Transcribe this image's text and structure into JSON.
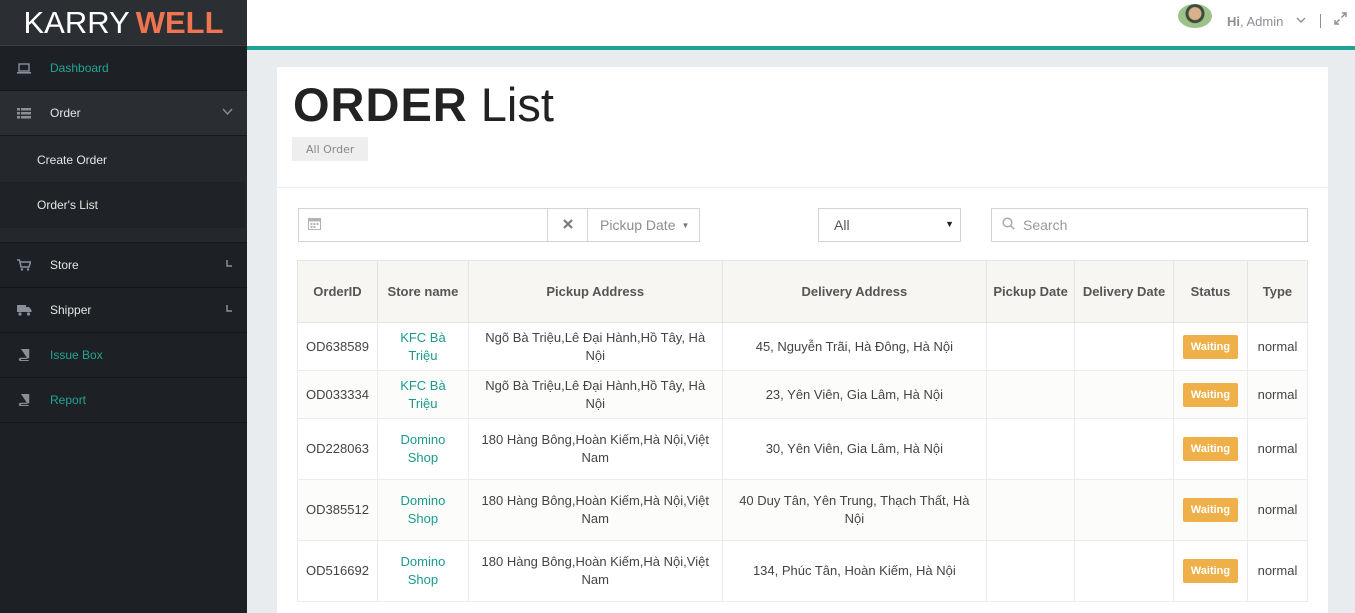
{
  "brand": {
    "first": "KARRY",
    "second": "WELL"
  },
  "sidebar": {
    "items": [
      {
        "label": "Dashboard",
        "icon": "laptop-icon"
      },
      {
        "label": "Order",
        "icon": "list-icon"
      },
      {
        "label": "Store",
        "icon": "cart-icon"
      },
      {
        "label": "Shipper",
        "icon": "truck-icon"
      },
      {
        "label": "Issue Box",
        "icon": "book-icon"
      },
      {
        "label": "Report",
        "icon": "book-icon"
      }
    ],
    "order_submenu": [
      {
        "label": "Create Order"
      },
      {
        "label": "Order's List"
      }
    ]
  },
  "header": {
    "greeting_bold": "Hi",
    "greeting_rest": ", Admin"
  },
  "page": {
    "title_bold": "ORDER",
    "title_light": "List",
    "breadcrumb": "All Order"
  },
  "filters": {
    "date_value": "",
    "pickup_date_label": "Pickup Date",
    "status_select": "All",
    "search_placeholder": "Search"
  },
  "table": {
    "headers": [
      "OrderID",
      "Store name",
      "Pickup Address",
      "Delivery Address",
      "Pickup Date",
      "Delivery Date",
      "Status",
      "Type"
    ],
    "rows": [
      {
        "id": "OD638589",
        "store": "KFC Bà Triệu",
        "pickup": "Ngõ Bà Triệu,Lê Đại Hành,Hồ Tây, Hà Nội",
        "delivery": "45, Nguyễn Trãi, Hà Đông, Hà Nội",
        "pickup_date": "",
        "delivery_date": "",
        "status": "Waiting",
        "type": "normal"
      },
      {
        "id": "OD033334",
        "store": "KFC Bà Triệu",
        "pickup": "Ngõ Bà Triệu,Lê Đại Hành,Hồ Tây, Hà Nội",
        "delivery": "23, Yên Viên, Gia Lâm, Hà Nội",
        "pickup_date": "",
        "delivery_date": "",
        "status": "Waiting",
        "type": "normal"
      },
      {
        "id": "OD228063",
        "store": "Domino Shop",
        "pickup": "180 Hàng Bông,Hoàn Kiếm,Hà Nội,Việt Nam",
        "delivery": "30, Yên Viên, Gia Lâm, Hà Nội",
        "pickup_date": "",
        "delivery_date": "",
        "status": "Waiting",
        "type": "normal"
      },
      {
        "id": "OD385512",
        "store": "Domino Shop",
        "pickup": "180 Hàng Bông,Hoàn Kiếm,Hà Nội,Việt Nam",
        "delivery": "40 Duy Tân, Yên Trung, Thạch Thất, Hà Nội",
        "pickup_date": "",
        "delivery_date": "",
        "status": "Waiting",
        "type": "normal"
      },
      {
        "id": "OD516692",
        "store": "Domino Shop",
        "pickup": "180 Hàng Bông,Hoàn Kiếm,Hà Nội,Việt Nam",
        "delivery": "134, Phúc Tân, Hoàn Kiếm, Hà Nội",
        "pickup_date": "",
        "delivery_date": "",
        "status": "Waiting",
        "type": "normal"
      }
    ]
  },
  "colors": {
    "accent": "#1fa195",
    "brand_orange": "#f0744f",
    "status_waiting": "#efb049",
    "sidebar_bg": "#1d2024"
  }
}
